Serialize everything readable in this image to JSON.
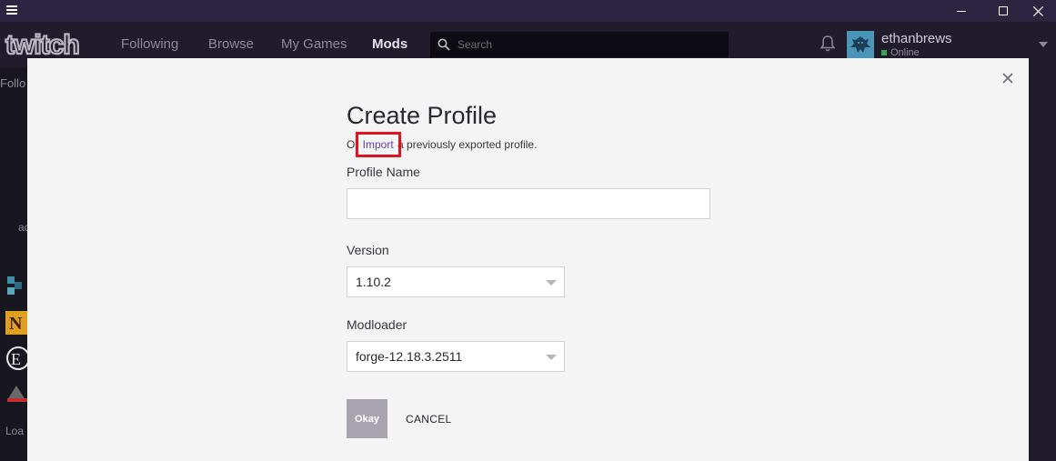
{
  "window": {
    "menu_icon": "hamburger-icon",
    "minimize_icon": "minimize-icon",
    "maximize_icon": "maximize-icon",
    "close_icon": "close-icon"
  },
  "nav": {
    "logo_text": "twitch",
    "items": [
      "Following",
      "Browse",
      "My Games",
      "Mods"
    ],
    "active": "Mods",
    "search_placeholder": "Search",
    "user": {
      "name": "ethanbrews",
      "status": "Online"
    }
  },
  "background": {
    "partial_text_1": "Follo",
    "partial_text_2": "ac",
    "partial_text_3": "Loa"
  },
  "modal": {
    "title": "Create Profile",
    "subline_prefix": "Or ",
    "import_link": "Import",
    "subline_suffix": " a previously exported profile.",
    "profile_name_label": "Profile Name",
    "profile_name_value": "",
    "version_label": "Version",
    "version_value": "1.10.2",
    "modloader_label": "Modloader",
    "modloader_value": "forge-12.18.3.2511",
    "okay_label": "Okay",
    "cancel_label": "CANCEL"
  },
  "colors": {
    "accent": "#6441a4",
    "highlight_box": "#e3101f",
    "titlebar": "#2c2541",
    "navbar": "#201c2b",
    "modal_bg": "#f4f4f4"
  }
}
